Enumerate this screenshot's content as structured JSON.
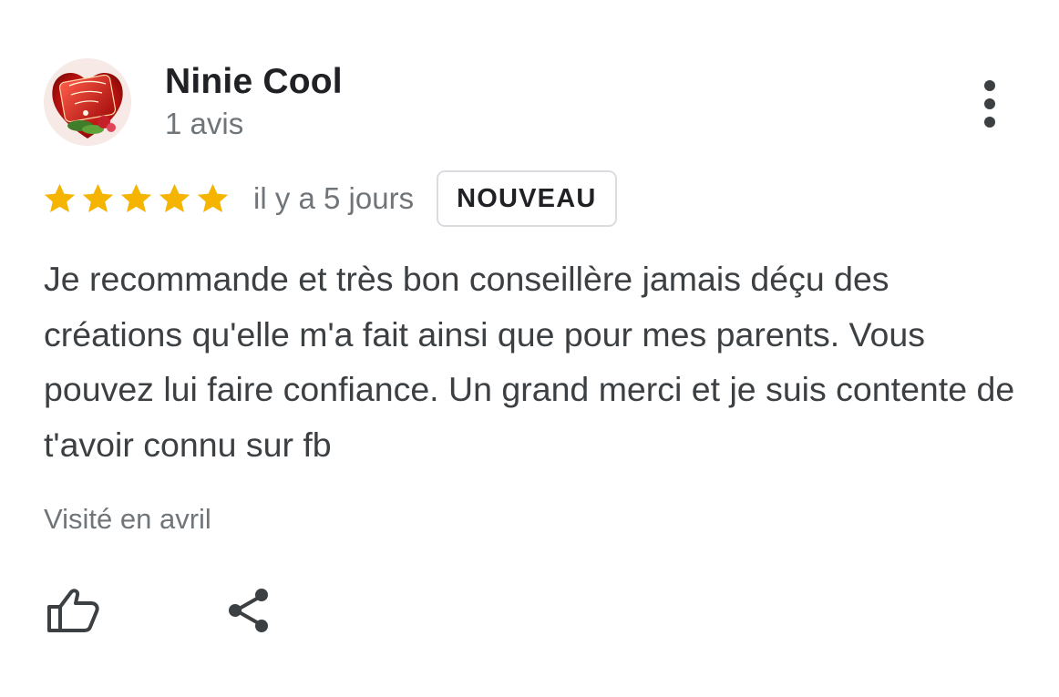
{
  "review": {
    "author_name": "Ninie Cool",
    "review_count": "1 avis",
    "avatar_icon": "red-heart-gift-avatar",
    "rating": 5,
    "rating_max": 5,
    "star_color": "#f4b400",
    "date": "il y a 5 jours",
    "badge": "NOUVEAU",
    "text": "Je recommande et très bon conseillère jamais déçu des créations qu'elle m'a fait ainsi que pour mes parents. Vous pouvez lui faire confiance. Un grand merci et je suis contente de t'avoir connu sur fb",
    "visited": "Visité en avril"
  },
  "actions": {
    "more_icon": "more-vertical-icon",
    "like_icon": "thumbs-up-icon",
    "share_icon": "share-icon"
  },
  "colors": {
    "primary_text": "#202124",
    "secondary_text": "#70757a",
    "body_text": "#3c4043",
    "badge_border": "#dadce0"
  }
}
